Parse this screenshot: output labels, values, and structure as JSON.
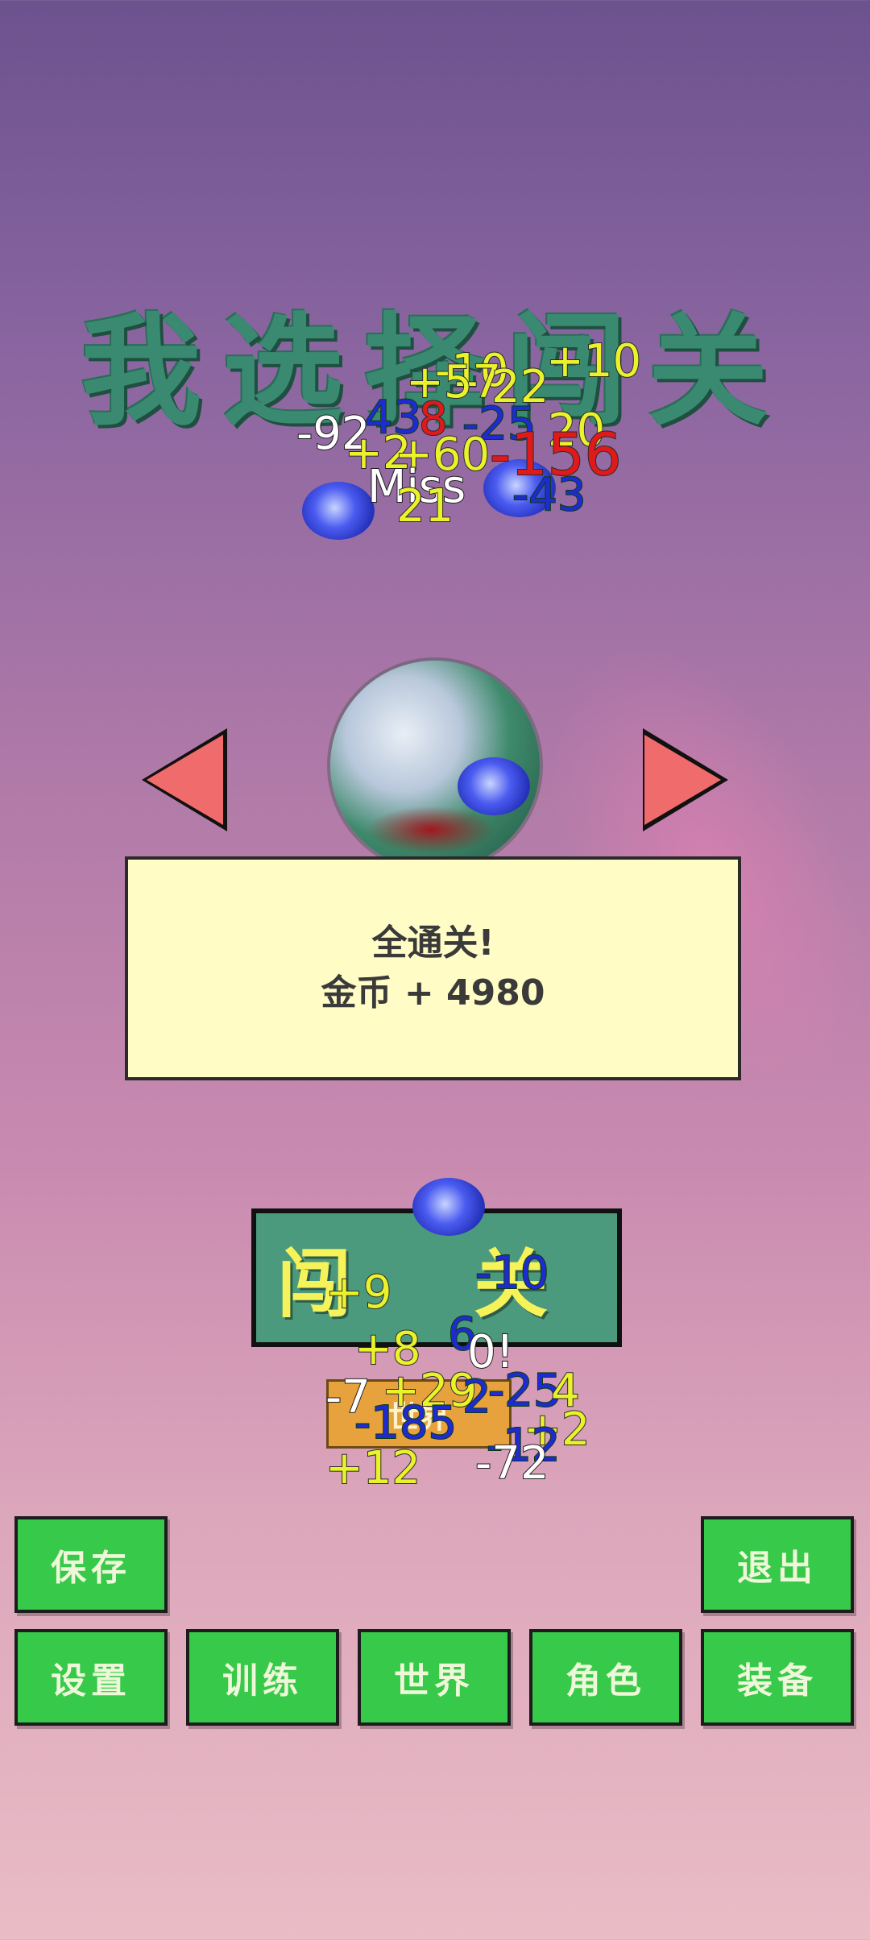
{
  "title": "我选择闯关",
  "stage_panel": {
    "line1": "全通关!",
    "line2": "金币 + 4980"
  },
  "buttons": {
    "start": "闯 关",
    "world": "世界",
    "save": "保存",
    "exit": "退出",
    "settings": "设置",
    "training": "训练",
    "world_menu": "世界",
    "character": "角色",
    "equipment": "装备"
  },
  "damage_numbers": {
    "top": [
      "-10",
      "+10",
      "+57",
      "22",
      "-92",
      "43",
      "8",
      "-25",
      "20",
      "+2",
      "+60",
      "-156",
      "Miss",
      "-43",
      "21"
    ],
    "bottom": [
      "-10",
      "+9",
      "+8",
      "6",
      "0!",
      "-7",
      "+29",
      "2",
      "-25",
      "4",
      "-185",
      "+2",
      "-12",
      "+12",
      "-72"
    ]
  },
  "colors": {
    "accent_green": "#36c94a",
    "panel_bg": "#fffcc6",
    "arrow_red": "#f06b6b",
    "title_green": "#3a8a72"
  }
}
